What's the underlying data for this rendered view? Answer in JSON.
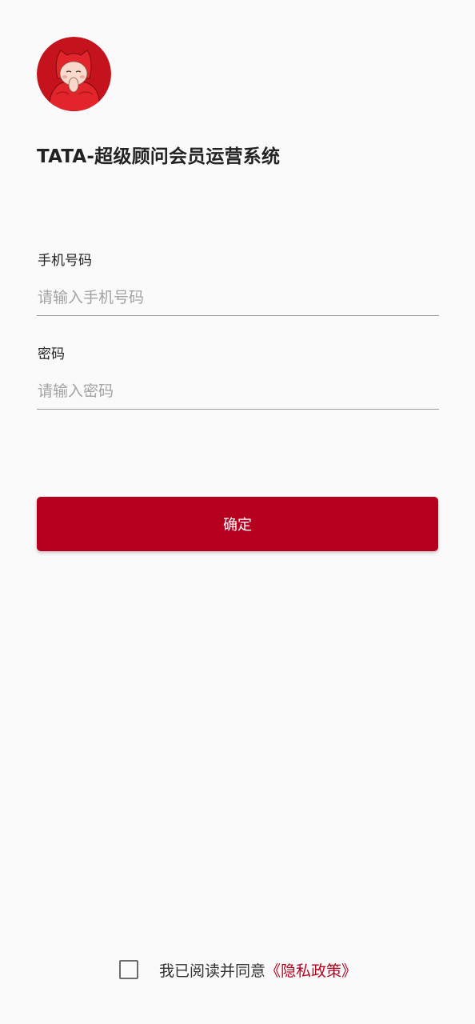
{
  "app": {
    "title": "TATA-超级顾问会员运营系统"
  },
  "form": {
    "phone_label": "手机号码",
    "phone_placeholder": "请输入手机号码",
    "phone_value": "",
    "password_label": "密码",
    "password_placeholder": "请输入密码",
    "password_value": "",
    "submit_label": "确定"
  },
  "agreement": {
    "checked": false,
    "text": "我已阅读并同意",
    "policy_link": "《隐私政策》"
  },
  "icons": {
    "logo": "mascot-logo-icon",
    "checkbox": "checkbox-unchecked-icon"
  },
  "colors": {
    "accent": "#b5001f",
    "background": "#fafafa",
    "input_border": "#9a9a9a",
    "placeholder": "#a3a3a3"
  }
}
